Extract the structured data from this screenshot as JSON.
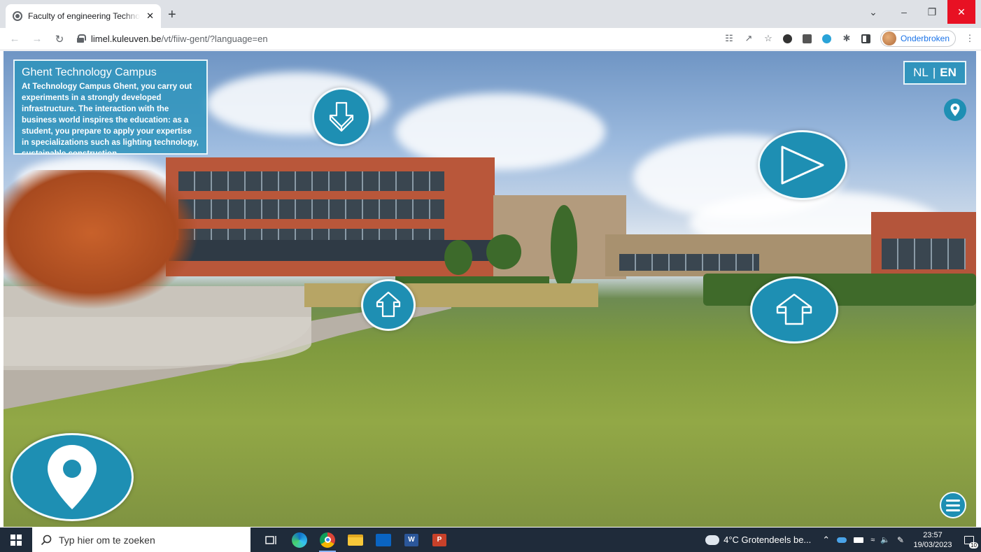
{
  "browser": {
    "tab_title": "Faculty of engineering Technology",
    "tab_close": "✕",
    "new_tab": "+",
    "url_host": "limel.kuleuven.be",
    "url_path": "/vt/fiiw-gent/?language=en",
    "profile_name": "Onderbroken",
    "window_controls": {
      "tab_search": "⌄",
      "minimize": "–",
      "restore": "❐",
      "close": "✕"
    }
  },
  "tour": {
    "info_title": "Ghent Technology Campus",
    "info_text": "At Technology Campus Ghent, you carry out experiments in a strongly developed infrastructure. The interaction with the business world inspires the education: as a student, you prepare to apply your expertise in specializations such as lighting technology, sustainable construction",
    "lang_nl": "NL",
    "lang_sep": "|",
    "lang_en": "EN",
    "accent_color": "#1e8fb3"
  },
  "taskbar": {
    "search_placeholder": "Typ hier om te zoeken",
    "weather": "4°C  Grotendeels be...",
    "time": "23:57",
    "date": "19/03/2023",
    "notifications": "10"
  }
}
